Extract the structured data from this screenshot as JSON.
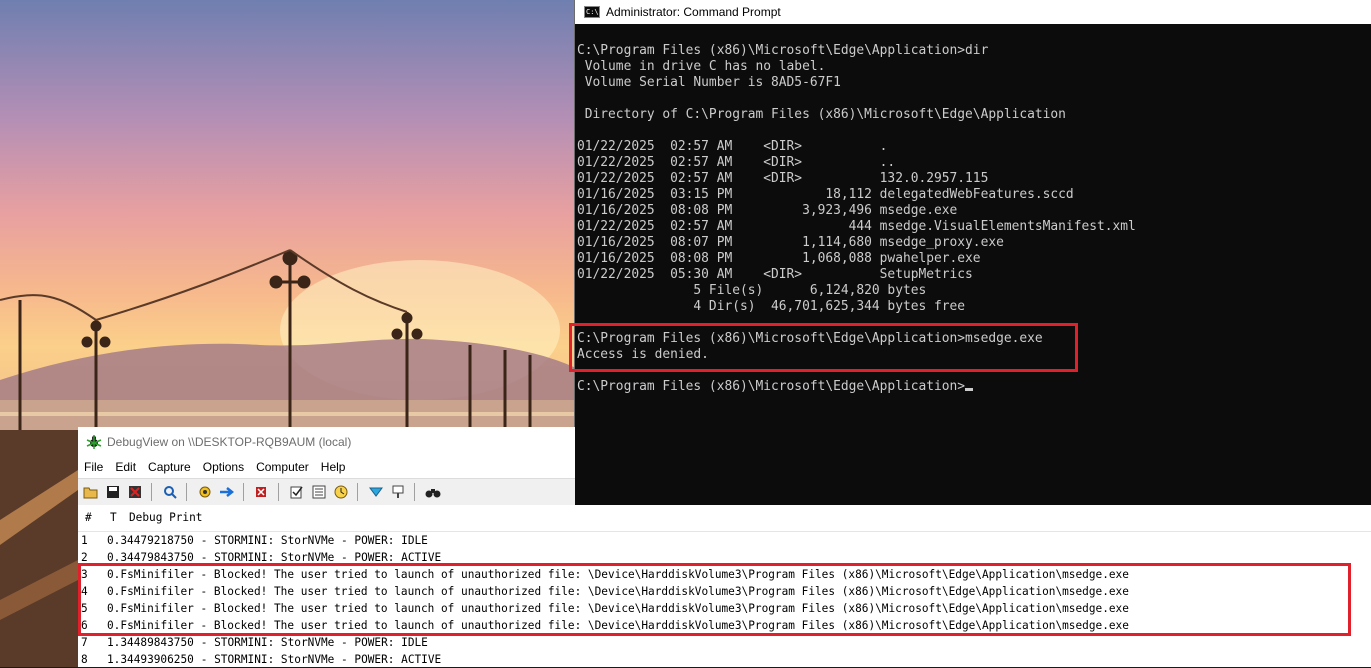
{
  "cmd_window": {
    "title": "Administrator: Command Prompt",
    "lines": [
      "C:\\Program Files (x86)\\Microsoft\\Edge\\Application>dir",
      " Volume in drive C has no label.",
      " Volume Serial Number is 8AD5-67F1",
      "",
      " Directory of C:\\Program Files (x86)\\Microsoft\\Edge\\Application",
      "",
      "01/22/2025  02:57 AM    <DIR>          .",
      "01/22/2025  02:57 AM    <DIR>          ..",
      "01/22/2025  02:57 AM    <DIR>          132.0.2957.115",
      "01/16/2025  03:15 PM            18,112 delegatedWebFeatures.sccd",
      "01/16/2025  08:08 PM         3,923,496 msedge.exe",
      "01/22/2025  02:57 AM               444 msedge.VisualElementsManifest.xml",
      "01/16/2025  08:07 PM         1,114,680 msedge_proxy.exe",
      "01/16/2025  08:08 PM         1,068,088 pwahelper.exe",
      "01/22/2025  05:30 AM    <DIR>          SetupMetrics",
      "               5 File(s)      6,124,820 bytes",
      "               4 Dir(s)  46,701,625,344 bytes free",
      "",
      "C:\\Program Files (x86)\\Microsoft\\Edge\\Application>msedge.exe",
      "Access is denied.",
      "",
      "C:\\Program Files (x86)\\Microsoft\\Edge\\Application>"
    ]
  },
  "debugview": {
    "title": "DebugView on \\\\DESKTOP-RQB9AUM (local)",
    "menu": [
      "File",
      "Edit",
      "Capture",
      "Options",
      "Computer",
      "Help"
    ],
    "toolbar_icons": [
      "open-icon",
      "save-icon",
      "clear-icon",
      "find-icon",
      "capture-icon",
      "autoscroll-icon",
      "clear-display-icon",
      "edit-filter-icon",
      "filter-icon",
      "time-icon",
      "highlight-icon",
      "history-icon",
      "find-binoculars-icon"
    ],
    "columns": [
      "#",
      "T",
      "Debug Print"
    ],
    "rows": [
      {
        "num": "1",
        "time": "0.34479218750",
        "text": " - STORMINI: StorNVMe - POWER: IDLE"
      },
      {
        "num": "2",
        "time": "0.34479843750",
        "text": " - STORMINI: StorNVMe - POWER: ACTIVE"
      },
      {
        "num": "3",
        "time": "0.",
        "text": "FsMinifiler - Blocked! The user tried to launch of unauthorized file: \\Device\\HarddiskVolume3\\Program Files (x86)\\Microsoft\\Edge\\Application\\msedge.exe"
      },
      {
        "num": "4",
        "time": "0.",
        "text": "FsMinifiler - Blocked! The user tried to launch of unauthorized file: \\Device\\HarddiskVolume3\\Program Files (x86)\\Microsoft\\Edge\\Application\\msedge.exe"
      },
      {
        "num": "5",
        "time": "0.",
        "text": "FsMinifiler - Blocked! The user tried to launch of unauthorized file: \\Device\\HarddiskVolume3\\Program Files (x86)\\Microsoft\\Edge\\Application\\msedge.exe"
      },
      {
        "num": "6",
        "time": "0.",
        "text": "FsMinifiler - Blocked! The user tried to launch of unauthorized file: \\Device\\HarddiskVolume3\\Program Files (x86)\\Microsoft\\Edge\\Application\\msedge.exe"
      },
      {
        "num": "7",
        "time": "1.34489843750",
        "text": " - STORMINI: StorNVMe - POWER: IDLE"
      },
      {
        "num": "8",
        "time": "1.34493906250",
        "text": " - STORMINI: StorNVMe - POWER: ACTIVE"
      }
    ]
  },
  "colors": {
    "highlight": "#e0202a",
    "console_bg": "#0c0c0c",
    "console_fg": "#cccccc"
  }
}
